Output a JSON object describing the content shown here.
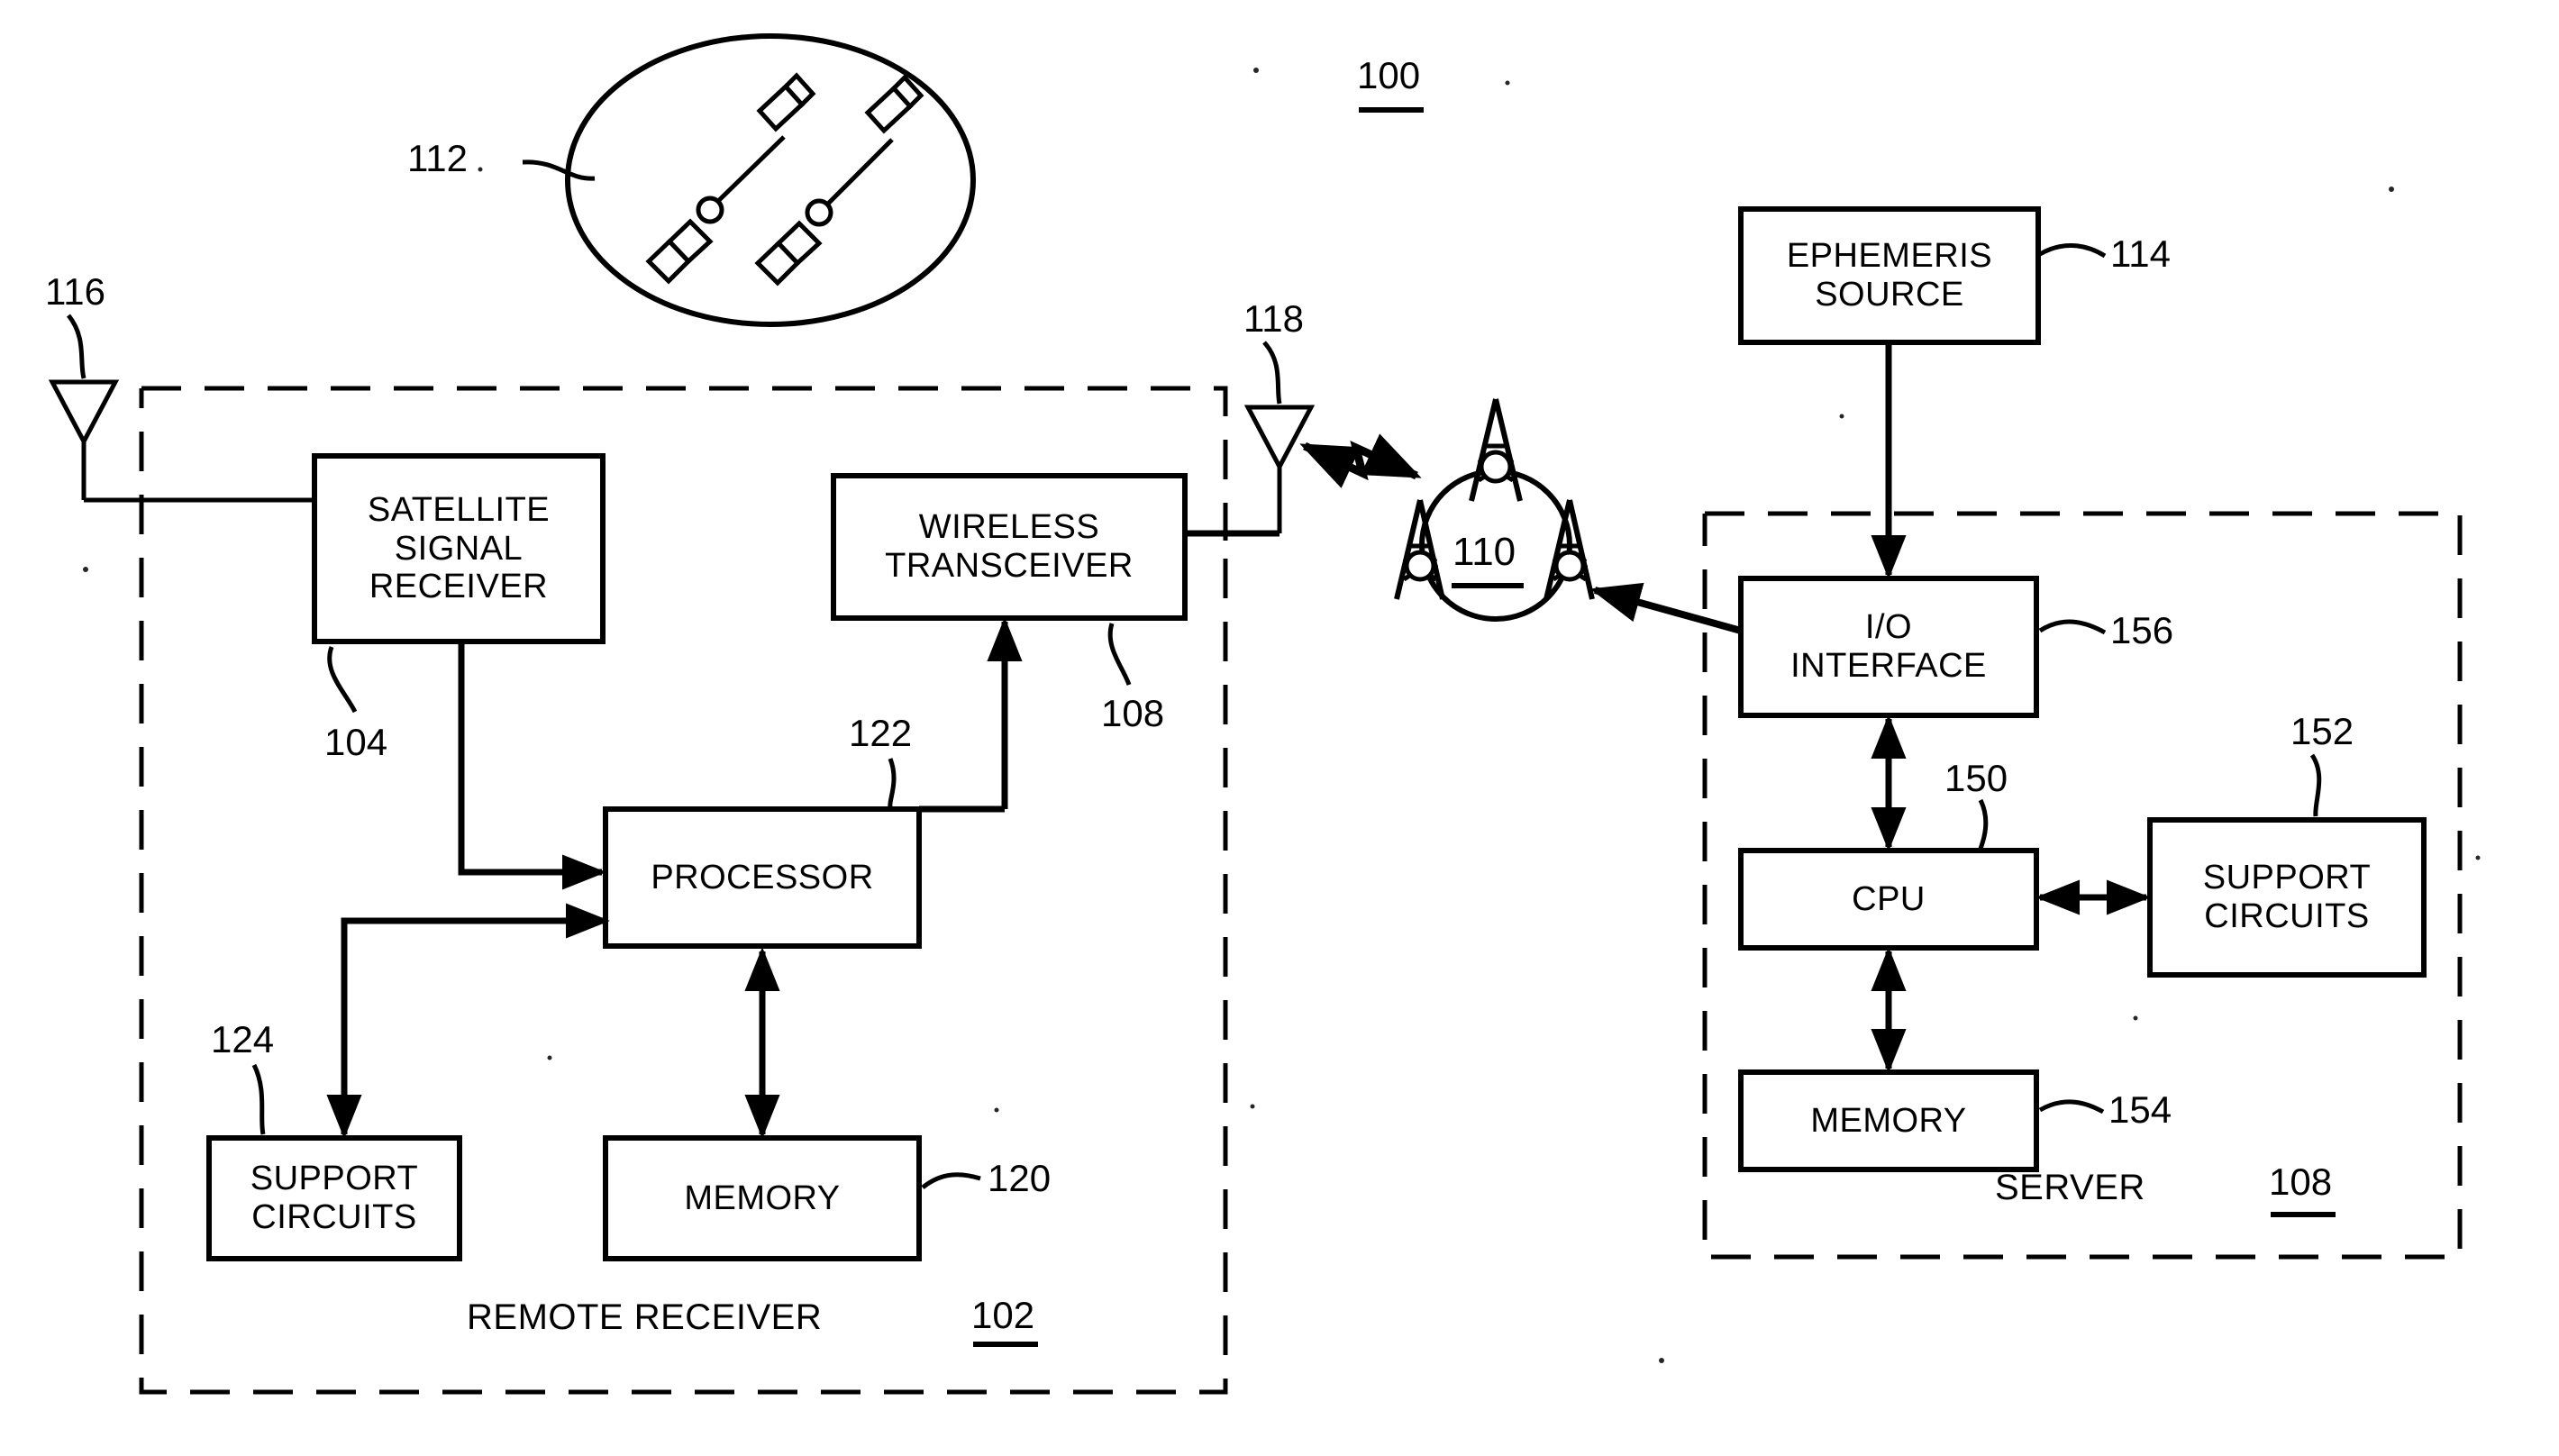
{
  "figure": {
    "top_reference": "100",
    "constellation_reference": "112",
    "satellite_antenna_reference": "116",
    "wireless_antenna_reference": "118",
    "network_reference": "110"
  },
  "remote_receiver": {
    "label": "REMOTE RECEIVER",
    "reference": "102",
    "blocks": [
      {
        "id": "satellite-signal-receiver",
        "lines": [
          "SATELLITE",
          "SIGNAL",
          "RECEIVER"
        ],
        "reference": "104"
      },
      {
        "id": "wireless-transceiver",
        "lines": [
          "WIRELESS",
          "TRANSCEIVER"
        ],
        "reference": "108"
      },
      {
        "id": "processor",
        "lines": [
          "PROCESSOR"
        ],
        "reference": "122"
      },
      {
        "id": "support-circuits",
        "lines": [
          "SUPPORT",
          "CIRCUITS"
        ],
        "reference": "124"
      },
      {
        "id": "memory",
        "lines": [
          "MEMORY"
        ],
        "reference": "120"
      }
    ]
  },
  "server": {
    "label": "SERVER",
    "reference": "108",
    "blocks": [
      {
        "id": "ephemeris-source",
        "lines": [
          "EPHEMERIS",
          "SOURCE"
        ],
        "reference": "114"
      },
      {
        "id": "io-interface",
        "lines": [
          "I/O",
          "INTERFACE"
        ],
        "reference": "156"
      },
      {
        "id": "cpu",
        "lines": [
          "CPU"
        ],
        "reference": "150"
      },
      {
        "id": "support-circuits",
        "lines": [
          "SUPPORT",
          "CIRCUITS"
        ],
        "reference": "152"
      },
      {
        "id": "memory",
        "lines": [
          "MEMORY"
        ],
        "reference": "154"
      }
    ]
  },
  "colors": {
    "ink": "#000000",
    "paper": "#ffffff"
  }
}
